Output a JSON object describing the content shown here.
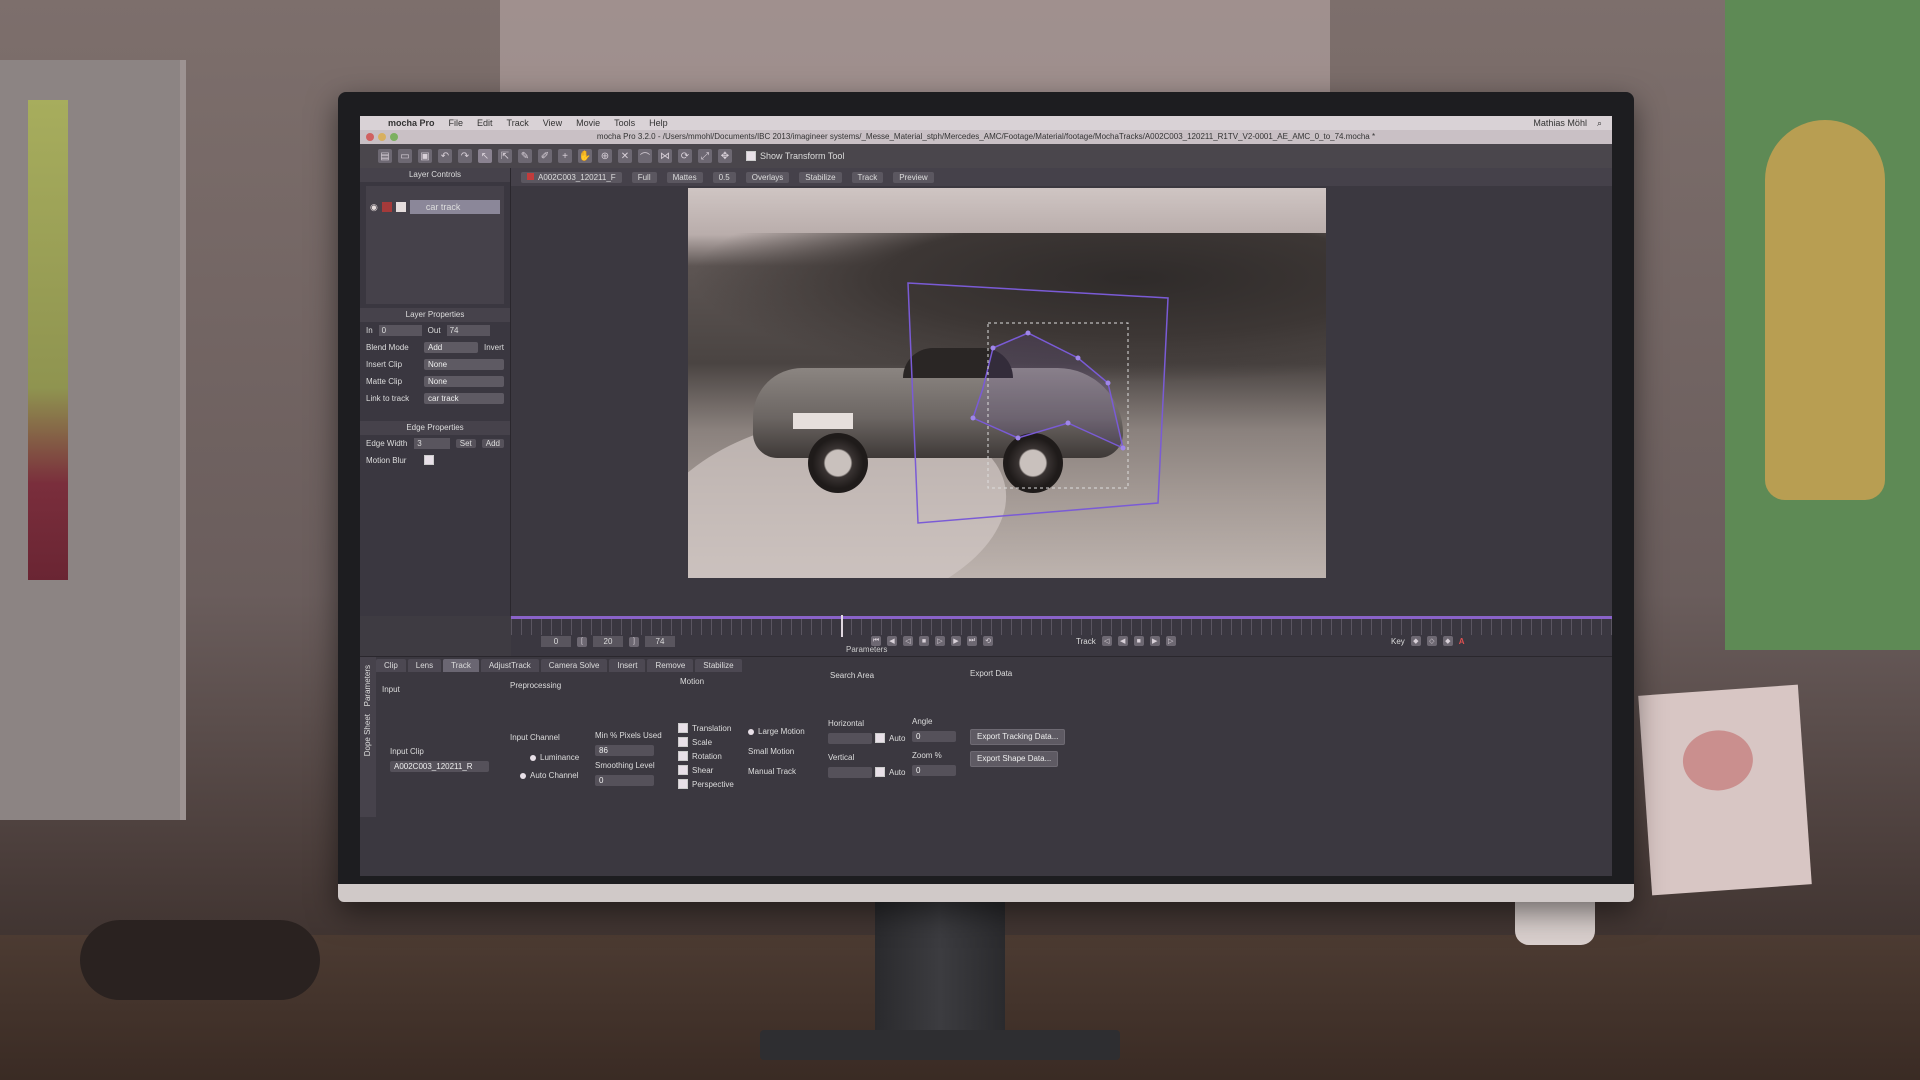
{
  "menubar": {
    "apple": "",
    "app": "mocha Pro",
    "items": [
      "File",
      "Edit",
      "Track",
      "View",
      "Movie",
      "Tools",
      "Help"
    ],
    "right": [
      "Mathias Möhl"
    ]
  },
  "titlebar": {
    "title": "mocha Pro 3.2.0 - /Users/mmohl/Documents/IBC 2013/imagineer systems/_Messe_Material_stph/Mercedes_AMC/Footage/Material/footage/MochaTracks/A002C003_120211_R1TV_V2-0001_AE_AMC_0_to_74.mocha *"
  },
  "toolbar": {
    "show_transform_label": "Show Transform Tool"
  },
  "layer_controls": {
    "header": "Layer Controls",
    "layer_name": "car track"
  },
  "layer_properties": {
    "header": "Layer Properties",
    "in_label": "In",
    "in_value": "0",
    "out_label": "Out",
    "out_value": "74",
    "blend_mode_label": "Blend Mode",
    "blend_mode_value": "Add",
    "invert_label": "Invert",
    "insert_clip_label": "Insert Clip",
    "insert_clip_value": "None",
    "matte_clip_label": "Matte Clip",
    "matte_clip_value": "None",
    "link_label": "Link to track",
    "link_value": "car track"
  },
  "edge_properties": {
    "header": "Edge Properties",
    "edge_width_label": "Edge Width",
    "edge_width_value": "3",
    "set_label": "Set",
    "add_label": "Add",
    "motion_blur_label": "Motion Blur"
  },
  "viewer_bar": {
    "clip": "A002C003_120211_F",
    "res": "Full",
    "mattes": "Mattes",
    "opacity": "0.5",
    "overlays": "Overlays",
    "stabilize": "Stabilize",
    "track": "Track",
    "preview": "Preview"
  },
  "transport": {
    "in_value": "0",
    "current_value": "20",
    "out_value": "74",
    "track_label": "Track",
    "key_label": "Key",
    "key_letter": "A"
  },
  "params": {
    "label": "Parameters",
    "side_tabs": [
      "Parameters",
      "Dope Sheet"
    ],
    "tabs": [
      "Clip",
      "Lens",
      "Track",
      "AdjustTrack",
      "Camera Solve",
      "Insert",
      "Remove",
      "Stabilize"
    ],
    "active_tab": "Track",
    "input_header": "Input",
    "preprocessing_header": "Preprocessing",
    "motion_header": "Motion",
    "search_header": "Search Area",
    "export_header": "Export Data",
    "input_clip_label": "Input Clip",
    "input_clip_value": "A002C003_120211_R",
    "input_channel_label": "Input Channel",
    "luminance_label": "Luminance",
    "auto_channel_label": "Auto Channel",
    "min_pixels_label": "Min % Pixels Used",
    "min_pixels_value": "86",
    "smoothing_label": "Smoothing Level",
    "smoothing_value": "0",
    "motion_items": [
      "Translation",
      "Scale",
      "Rotation",
      "Shear",
      "Perspective"
    ],
    "large_motion": "Large Motion",
    "small_motion": "Small Motion",
    "manual_track": "Manual Track",
    "horizontal_label": "Horizontal",
    "vertical_label": "Vertical",
    "auto_label": "Auto",
    "angle_label": "Angle",
    "angle_value": "0",
    "zoom_label": "Zoom %",
    "zoom_value": "0",
    "export_tracking": "Export Tracking Data...",
    "export_shape": "Export Shape Data..."
  },
  "colors": {
    "accent": "#8a63c9",
    "track_shape": "#7a5bd6"
  }
}
